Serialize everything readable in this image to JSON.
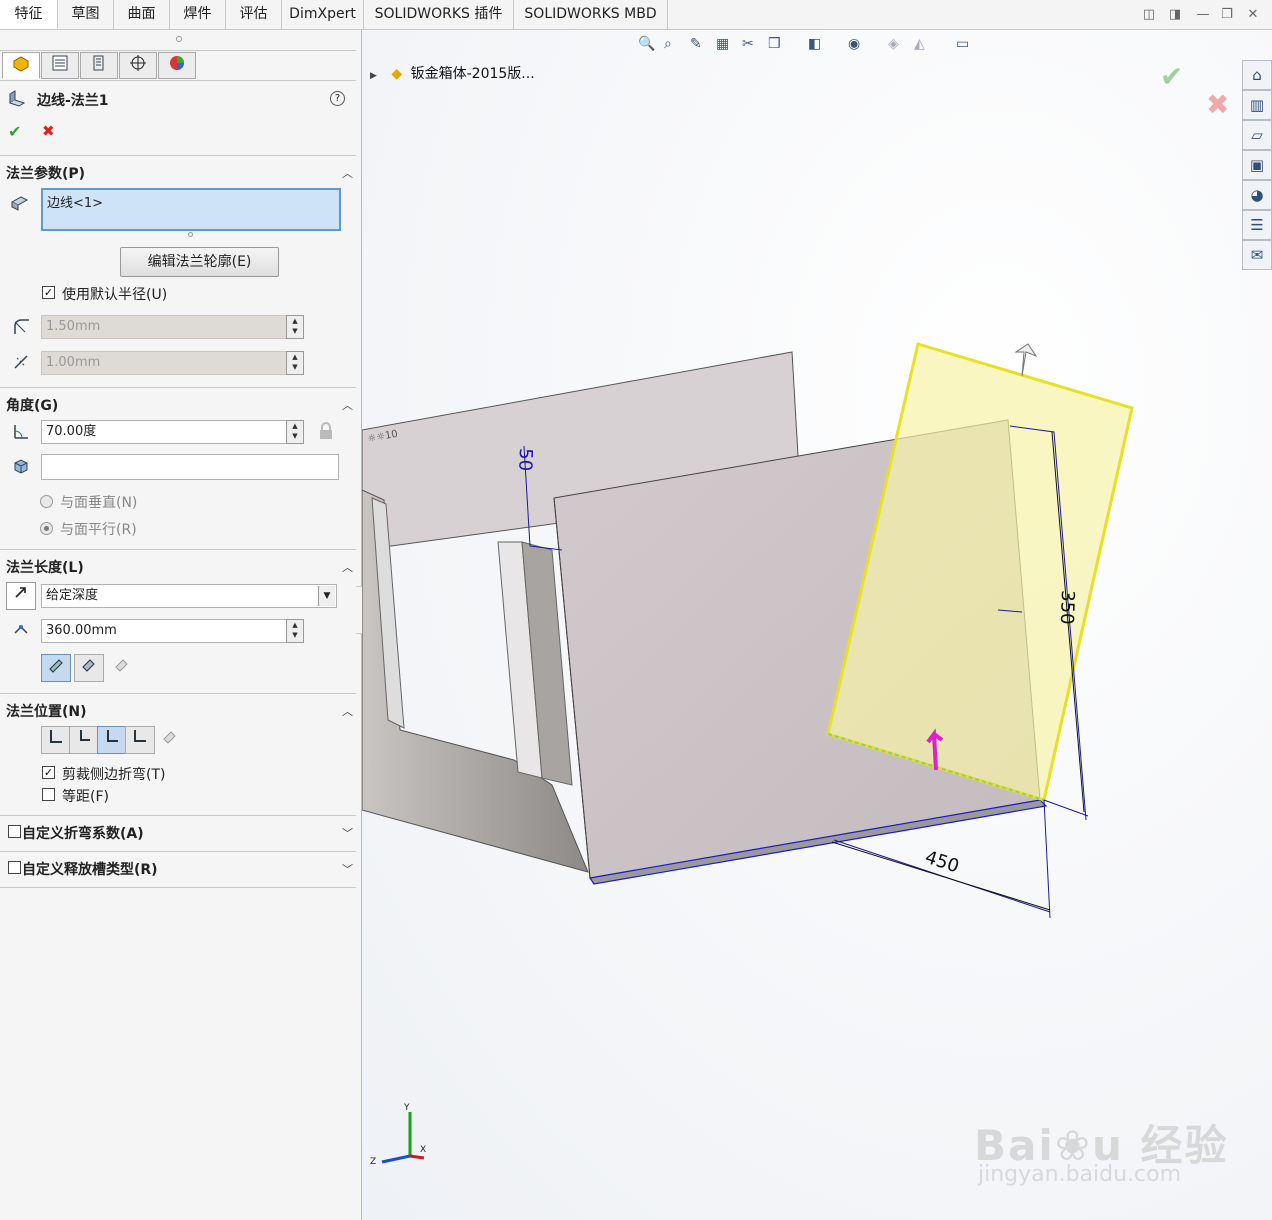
{
  "tabs": [
    "特征",
    "草图",
    "曲面",
    "焊件",
    "评估",
    "DimXpert",
    "SOLIDWORKS 插件",
    "SOLIDWORKS MBD"
  ],
  "active_tab": "特征",
  "window_controls": [
    "◫",
    "◨",
    "—",
    "❐",
    "✕"
  ],
  "pm": {
    "title": "边线-法兰1",
    "help": "?",
    "ok": "✔",
    "cancel": "✖",
    "flange_params": {
      "title": "法兰参数(P)",
      "selection": "边线<1>",
      "edit_button": "编辑法兰轮廓(E)",
      "use_default_radius": "使用默认半径(U)",
      "radius": "1.50mm",
      "gap": "1.00mm"
    },
    "angle": {
      "title": "角度(G)",
      "value": "70.00度",
      "face_select": "",
      "perpendicular": "与面垂直(N)",
      "parallel": "与面平行(R)"
    },
    "flange_length": {
      "title": "法兰长度(L)",
      "end_condition": "给定深度",
      "length": "360.00mm"
    },
    "flange_position": {
      "title": "法兰位置(N)",
      "trim_side_bends": "剪裁侧边折弯(T)",
      "offset": "等距(F)"
    },
    "custom_bend": "自定义折弯系数(A)",
    "custom_relief": "自定义释放槽类型(R)"
  },
  "viewport": {
    "tree_item": "钣金箱体-2015版...",
    "dims": {
      "d50": "50",
      "d350": "350",
      "d450": "450"
    },
    "triad": {
      "x": "X",
      "y": "Y",
      "z": "Z"
    },
    "watermark_sub": "jingyan.baidu.com"
  },
  "colors": {
    "preview_fill": "#f6f2a8",
    "preview_edge": "#e8e025",
    "dimension": "#1a1aa0",
    "accent": "#1e6fd0"
  }
}
